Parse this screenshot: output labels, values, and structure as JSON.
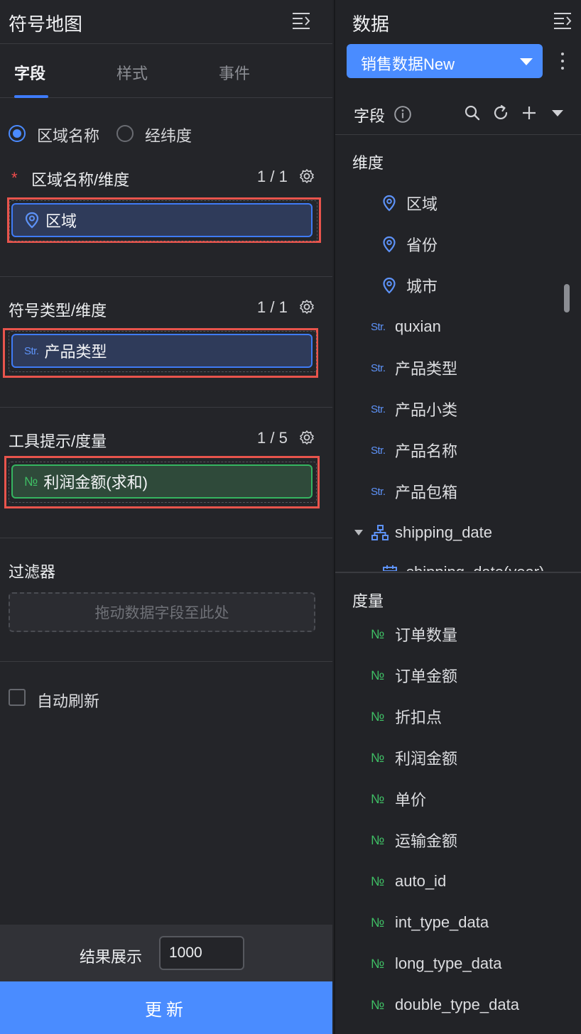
{
  "left_panel": {
    "title": "符号地图",
    "tabs": [
      {
        "label": "字段",
        "active": true
      },
      {
        "label": "样式",
        "active": false
      },
      {
        "label": "事件",
        "active": false
      }
    ],
    "radio_options": [
      {
        "label": "区域名称",
        "selected": true
      },
      {
        "label": "经纬度",
        "selected": false
      }
    ],
    "sections": {
      "region": {
        "required_mark": "*",
        "label": "区域名称/维度",
        "count": "1 / 1",
        "pill": {
          "icon": "location-pin-icon",
          "label": "区域"
        }
      },
      "symbol_type": {
        "label": "符号类型/维度",
        "count": "1 / 1",
        "pill": {
          "icon": "Str.",
          "label": "产品类型"
        }
      },
      "tooltip": {
        "label": "工具提示/度量",
        "count": "1 / 5",
        "pill": {
          "icon": "№",
          "label": "利润金额(求和)"
        }
      },
      "filter": {
        "label": "过滤器",
        "drop_hint": "拖动数据字段至此处"
      }
    },
    "auto_refresh": {
      "label": "自动刷新",
      "checked": false
    },
    "result": {
      "label": "结果展示",
      "value": "1000"
    },
    "update_button": "更新"
  },
  "right_panel": {
    "title": "数据",
    "dataset": "销售数据New",
    "fields_label": "字段",
    "dimension_group": {
      "label": "维度",
      "items": [
        {
          "type": "geo",
          "name": "区域"
        },
        {
          "type": "geo",
          "name": "省份"
        },
        {
          "type": "geo",
          "name": "城市"
        },
        {
          "type": "Str.",
          "name": "quxian"
        },
        {
          "type": "Str.",
          "name": "产品类型"
        },
        {
          "type": "Str.",
          "name": "产品小类"
        },
        {
          "type": "Str.",
          "name": "产品名称"
        },
        {
          "type": "Str.",
          "name": "产品包箱"
        },
        {
          "type": "hierarchy",
          "name": "shipping_date"
        },
        {
          "type": "date",
          "name": "shipping_date(year)"
        }
      ]
    },
    "measure_group": {
      "label": "度量",
      "items": [
        {
          "type": "№",
          "name": "订单数量"
        },
        {
          "type": "№",
          "name": "订单金额"
        },
        {
          "type": "№",
          "name": "折扣点"
        },
        {
          "type": "№",
          "name": "利润金额"
        },
        {
          "type": "№",
          "name": "单价"
        },
        {
          "type": "№",
          "name": "运输金额"
        },
        {
          "type": "№",
          "name": "auto_id"
        },
        {
          "type": "№",
          "name": "int_type_data"
        },
        {
          "type": "№",
          "name": "long_type_data"
        },
        {
          "type": "№",
          "name": "double_type_data"
        }
      ]
    }
  },
  "colors": {
    "accent_blue": "#4a8cff",
    "highlight_red": "#e8544c",
    "measure_green": "#3fbf65",
    "dimension_blue": "#3f7bf5"
  }
}
